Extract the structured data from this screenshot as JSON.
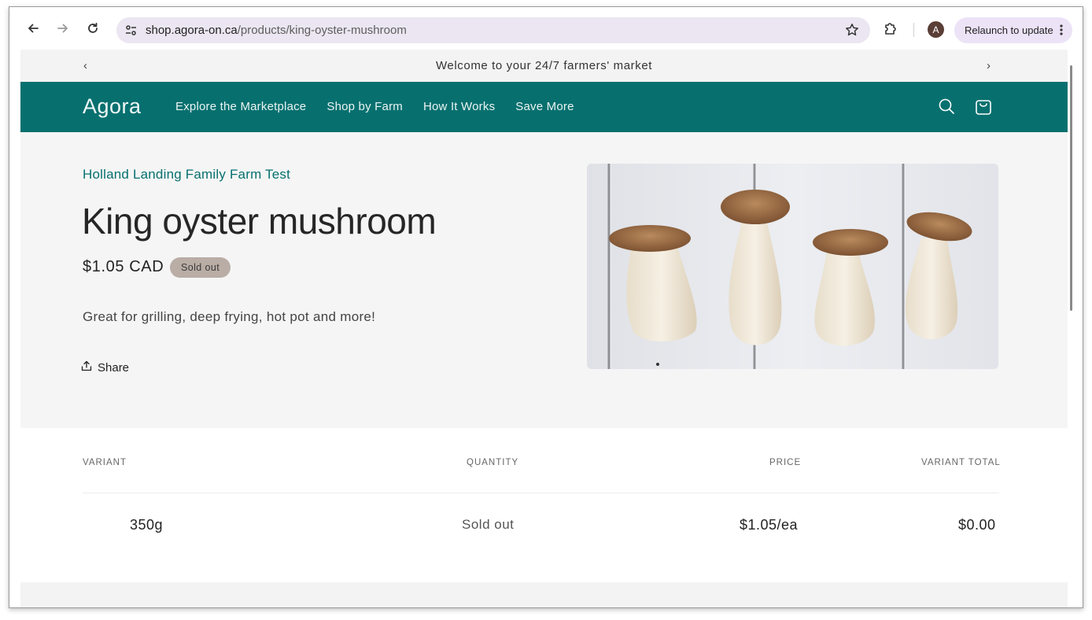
{
  "browser": {
    "url_host": "shop.agora-on.ca",
    "url_path": "/products/king-oyster-mushroom",
    "avatar_letter": "A",
    "relaunch_label": "Relaunch to update"
  },
  "announcement": {
    "text": "Welcome to your 24/7 farmers' market",
    "prev": "‹",
    "next": "›"
  },
  "header": {
    "logo": "Agora",
    "nav": [
      "Explore the Marketplace",
      "Shop by Farm",
      "How It Works",
      "Save More"
    ]
  },
  "product": {
    "vendor": "Holland Landing Family Farm Test",
    "title": "King oyster mushroom",
    "price": "$1.05 CAD",
    "badge": "Sold out",
    "description": "Great for grilling, deep frying, hot pot and more!",
    "share_label": "Share"
  },
  "variants": {
    "headers": {
      "variant": "VARIANT",
      "quantity": "QUANTITY",
      "price": "PRICE",
      "total": "VARIANT TOTAL"
    },
    "rows": [
      {
        "variant": "350g",
        "quantity": "Sold out",
        "price": "$1.05/ea",
        "total": "$0.00"
      }
    ]
  },
  "colors": {
    "brand_teal": "#07706f",
    "badge_bg": "#b9ada5",
    "page_bg": "#f5f5f5"
  }
}
